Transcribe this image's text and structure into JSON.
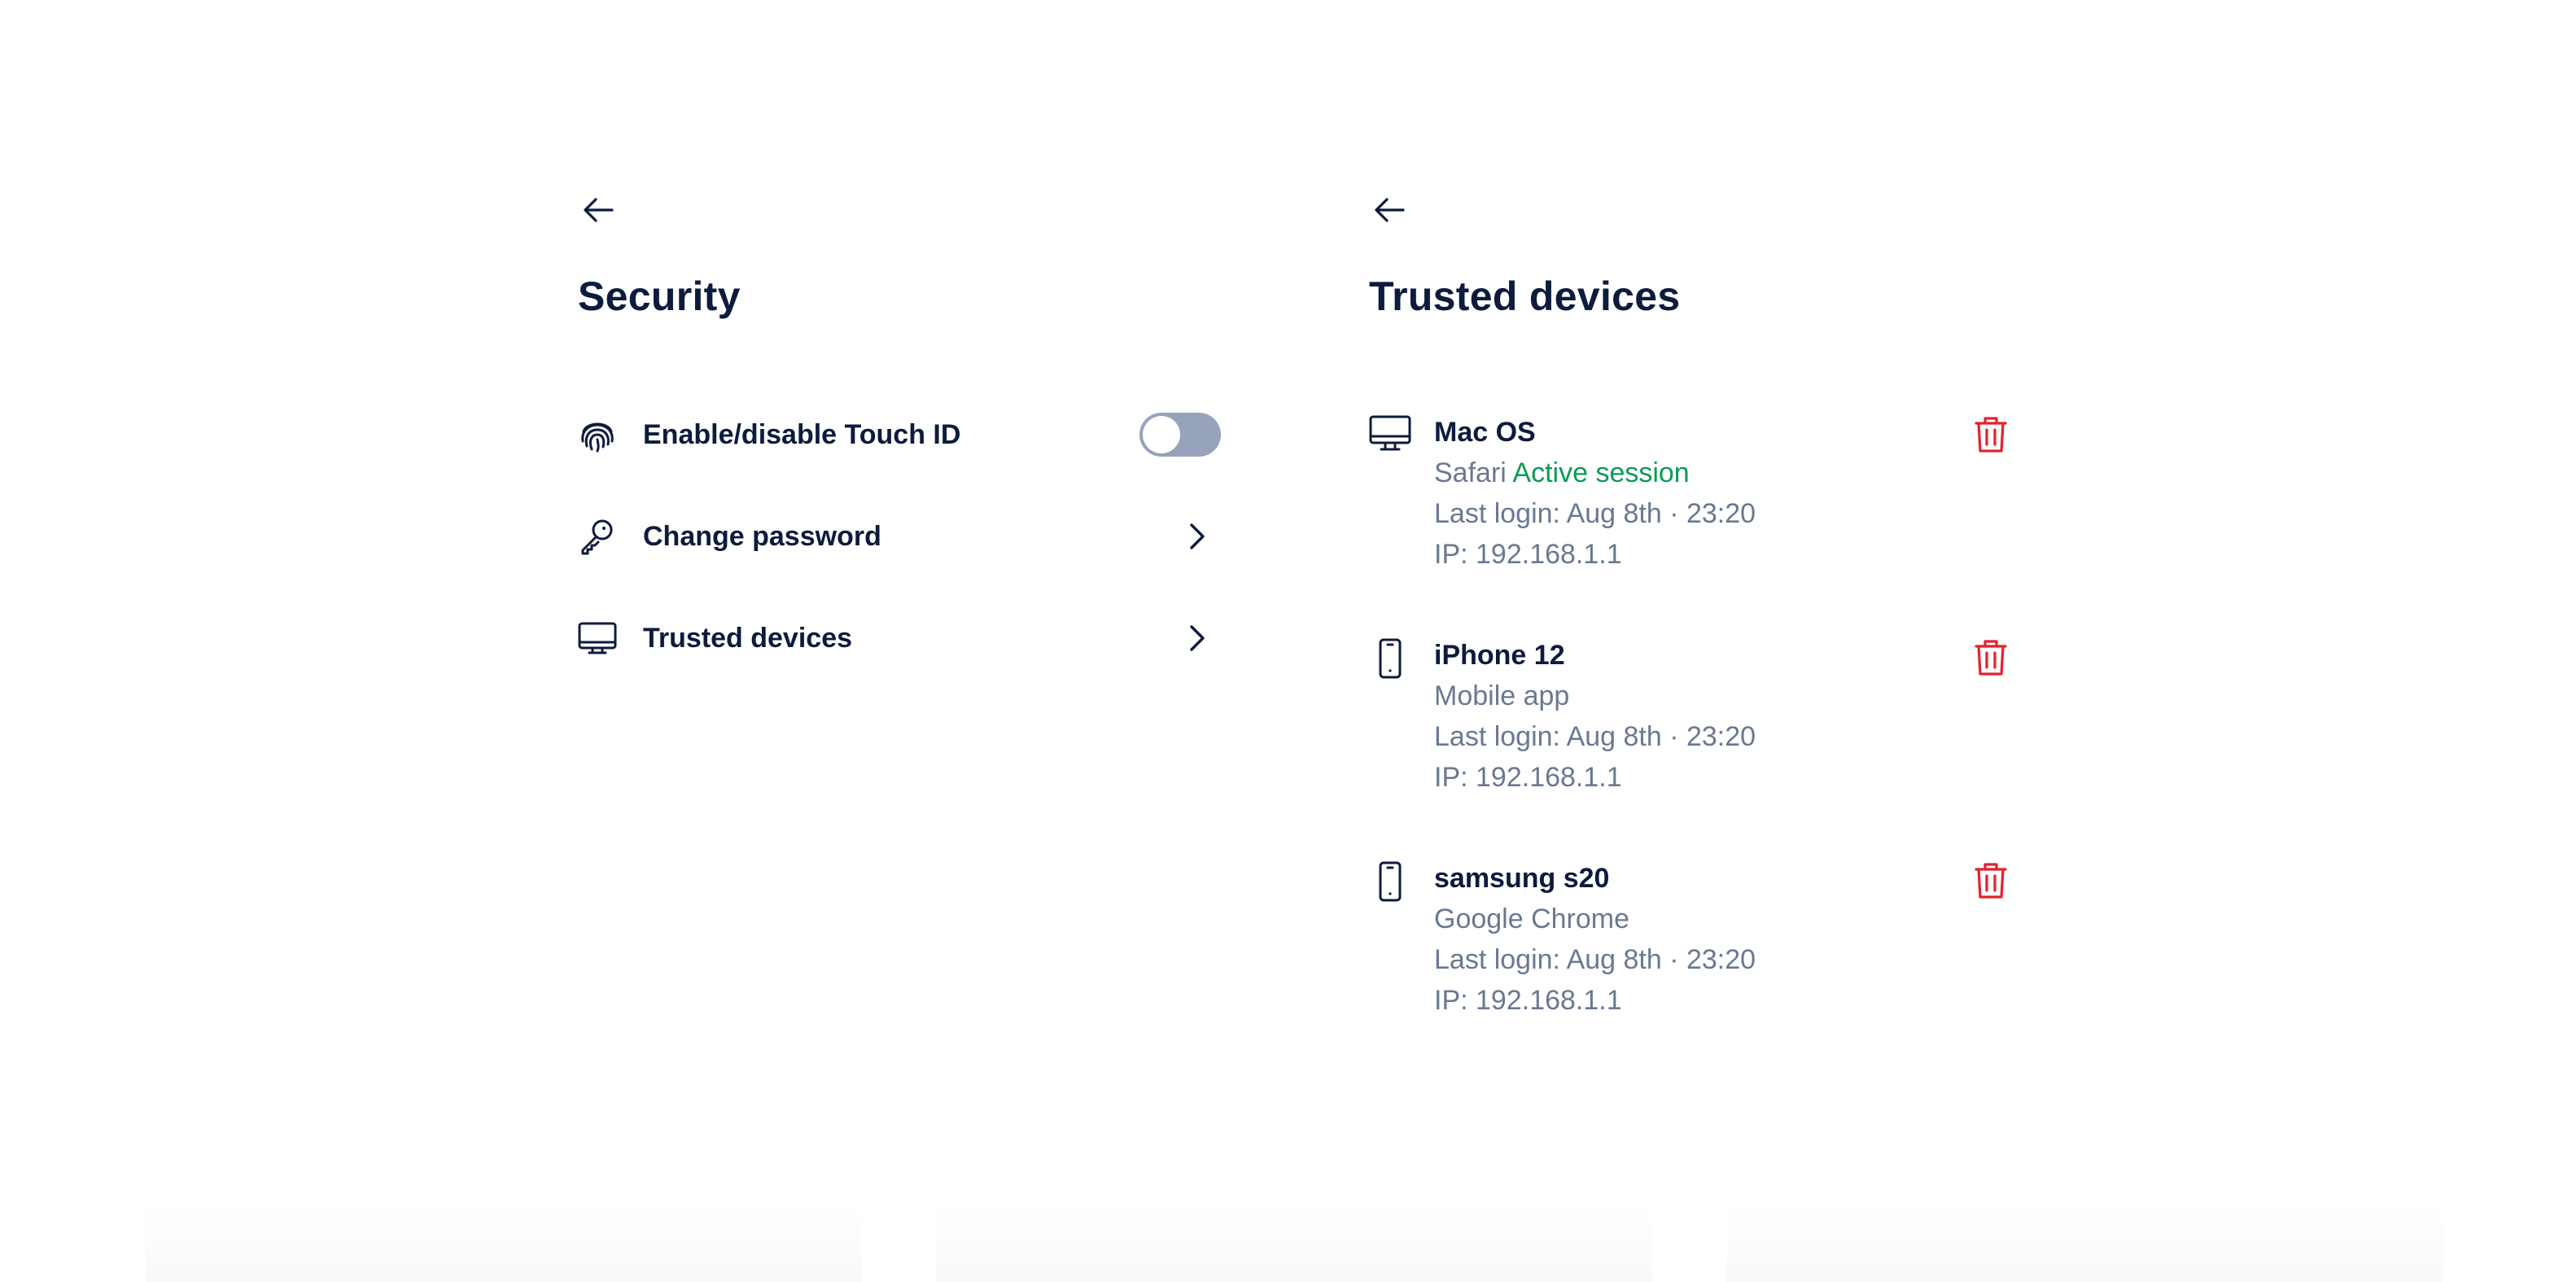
{
  "security": {
    "title": "Security",
    "items": [
      {
        "label": "Enable/disable Touch ID",
        "icon": "fingerprint-icon",
        "control": "toggle",
        "enabled": false
      },
      {
        "label": "Change password",
        "icon": "key-icon",
        "control": "chevron"
      },
      {
        "label": "Trusted devices",
        "icon": "monitor-icon",
        "control": "chevron"
      }
    ]
  },
  "trusted_devices": {
    "title": "Trusted devices",
    "devices": [
      {
        "name": "Mac OS",
        "icon": "desktop-icon",
        "client": "Safari",
        "status": "Active session",
        "last_login": "Last login: Aug 8th · 23:20",
        "ip": "IP: 192.168.1.1"
      },
      {
        "name": "iPhone 12",
        "icon": "phone-icon",
        "client": "Mobile app",
        "last_login": "Last login: Aug 8th · 23:20",
        "ip": "IP: 192.168.1.1"
      },
      {
        "name": "samsung s20",
        "icon": "phone-icon",
        "client": "Google Chrome",
        "last_login": "Last login: Aug 8th · 23:20",
        "ip": "IP: 192.168.1.1"
      }
    ]
  },
  "colors": {
    "text_primary": "#0d1b3d",
    "text_secondary": "#6a7892",
    "active_green": "#0a9b55",
    "delete_red": "#e5202e",
    "toggle_off": "#97a3bb"
  }
}
